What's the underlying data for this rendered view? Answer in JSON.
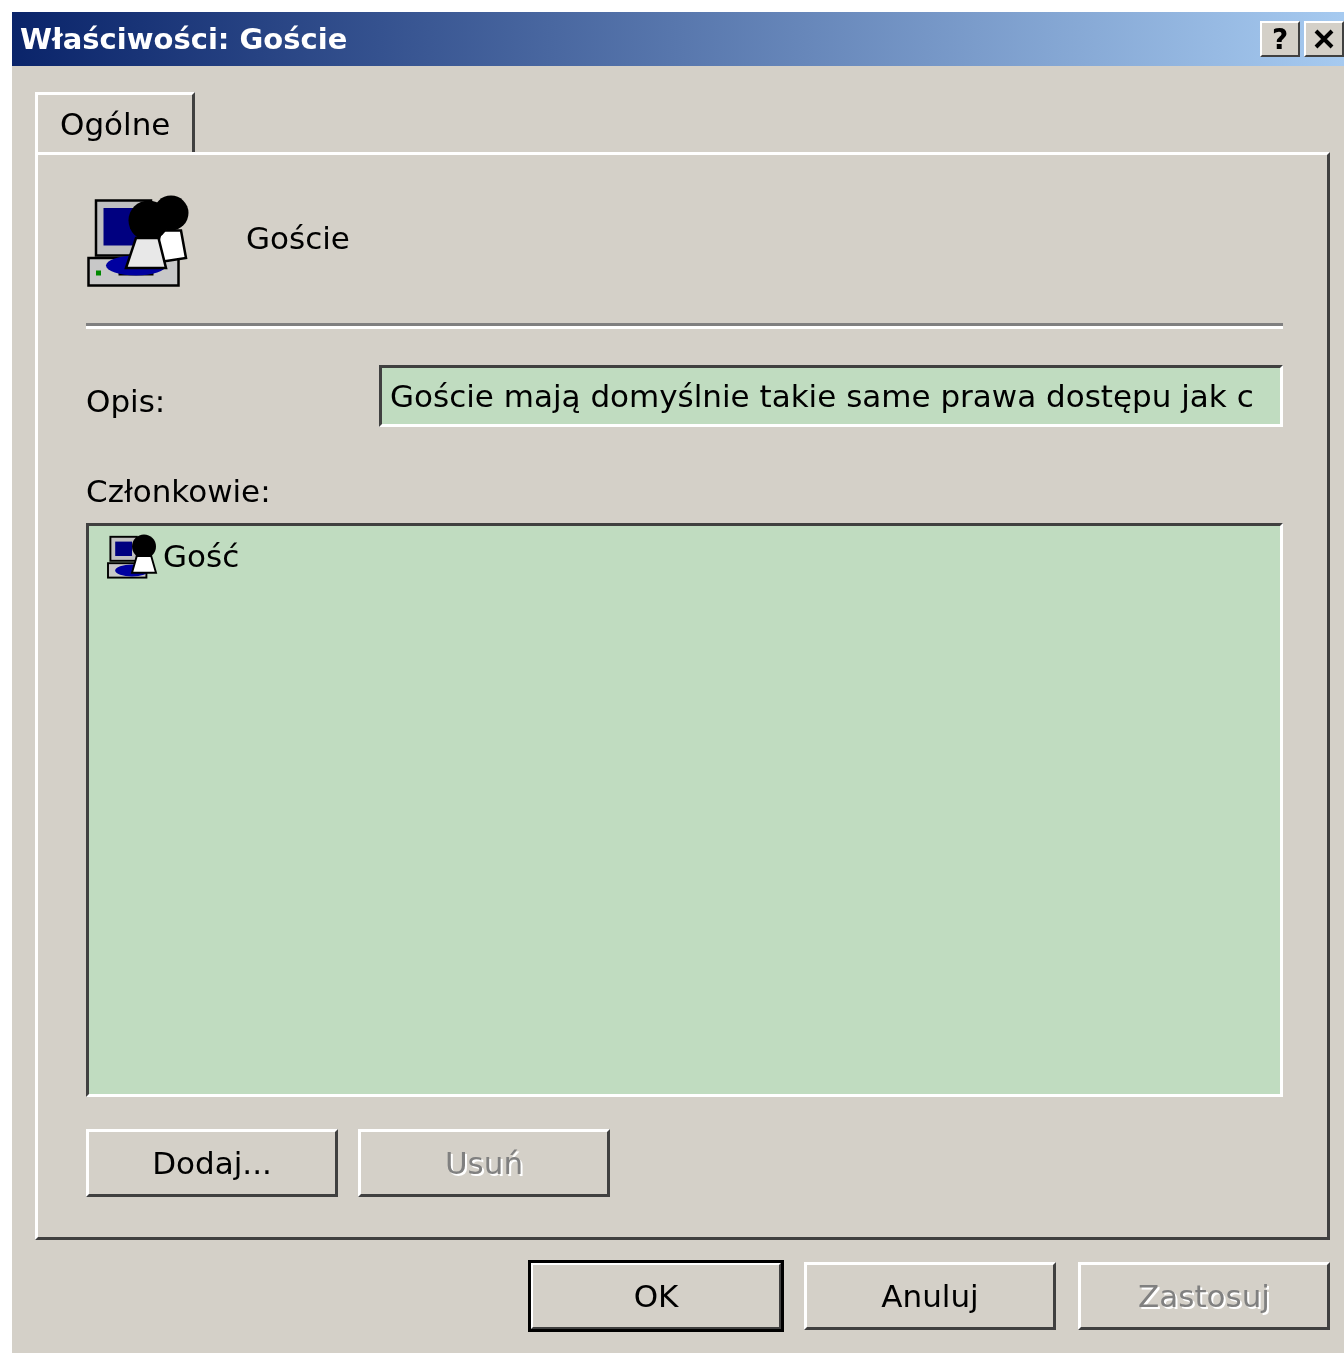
{
  "window": {
    "title": "Właściwości: Goście",
    "help_button": "?"
  },
  "tabs": [
    {
      "label": "Ogólne",
      "selected": true
    }
  ],
  "group": {
    "name": "Goście"
  },
  "description": {
    "label": "Opis:",
    "value": "Goście mają domyślnie takie same prawa dostępu jak c"
  },
  "members": {
    "label": "Członkowie:",
    "items": [
      {
        "name": "Gość",
        "selected": false
      }
    ]
  },
  "member_buttons": [
    {
      "label": "Dodaj...",
      "disabled": false
    },
    {
      "label": "Usuń",
      "disabled": true
    }
  ],
  "buttons": [
    {
      "label": "OK",
      "default": true,
      "disabled": false
    },
    {
      "label": "Anuluj",
      "default": false,
      "disabled": false
    },
    {
      "label": "Zastosuj",
      "default": false,
      "disabled": true
    }
  ]
}
